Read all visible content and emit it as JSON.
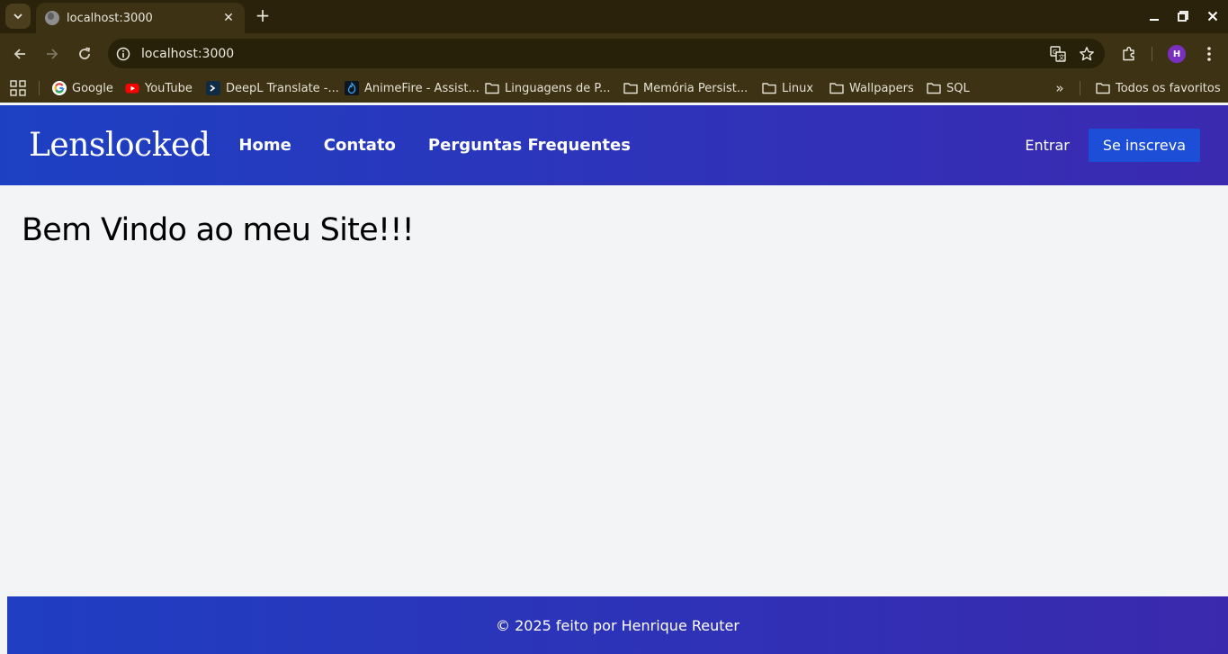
{
  "browser": {
    "tab": {
      "title": "localhost:3000"
    },
    "address": {
      "url": "localhost:3000"
    },
    "profile_initial": "H",
    "bookmarks": [
      {
        "label": "Google",
        "icon": "google-icon"
      },
      {
        "label": "YouTube",
        "icon": "youtube-icon"
      },
      {
        "label": "DeepL Translate -...",
        "icon": "deepl-icon"
      },
      {
        "label": "AnimeFire - Assist...",
        "icon": "animefire-icon"
      },
      {
        "label": "Linguagens de P...",
        "icon": "folder-icon"
      },
      {
        "label": "Memória Persist...",
        "icon": "folder-icon"
      },
      {
        "label": "Linux",
        "icon": "folder-icon"
      },
      {
        "label": "Wallpapers",
        "icon": "folder-icon"
      },
      {
        "label": "SQL",
        "icon": "folder-icon"
      }
    ],
    "all_bookmarks_label": "Todos os favoritos"
  },
  "site": {
    "logo": "Lenslocked",
    "nav": {
      "home": "Home",
      "contact": "Contato",
      "faq": "Perguntas Frequentes"
    },
    "auth": {
      "login": "Entrar",
      "signup": "Se inscreva"
    },
    "main": {
      "heading": "Bem Vindo ao meu Site!!!"
    },
    "footer": {
      "text": "© 2025 feito por Henrique Reuter"
    }
  },
  "colors": {
    "chrome_bg": "#3d3214",
    "header_gradient_start": "#1d40c2",
    "header_gradient_end": "#3a2ab0",
    "signup_button": "#1d4ed8",
    "page_bg": "#f3f4f6"
  }
}
